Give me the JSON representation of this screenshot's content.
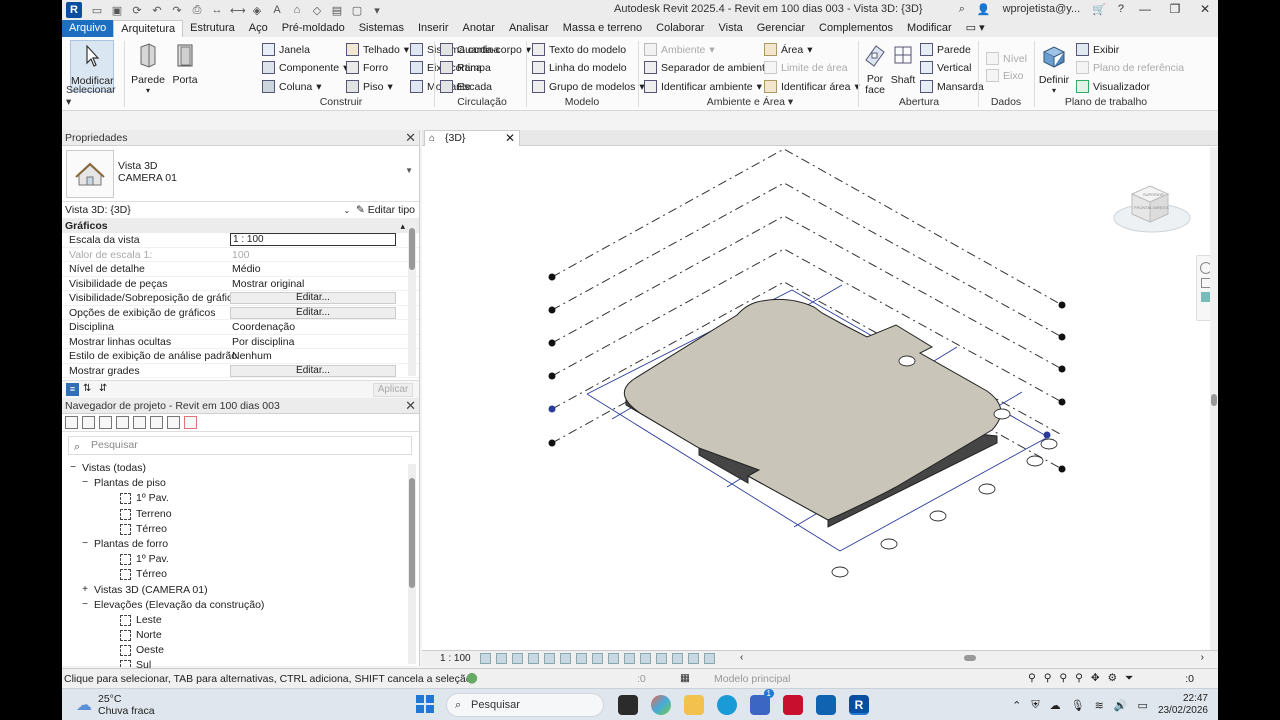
{
  "titlebar": {
    "title": "Autodesk Revit 2025.4 - Revit em 100 dias 003 - Vista 3D: {3D}",
    "user": "wprojetista@y...",
    "help": "?"
  },
  "tabs": [
    "Arquivo",
    "Arquitetura",
    "Estrutura",
    "Aço",
    "Pré-moldado",
    "Sistemas",
    "Inserir",
    "Anotar",
    "Analisar",
    "Massa e terreno",
    "Colaborar",
    "Vista",
    "Gerenciar",
    "Complementos",
    "Modificar"
  ],
  "ribbon": {
    "select": {
      "modify": "Modificar",
      "title": "Selecionar"
    },
    "build": {
      "title": "Construir",
      "wall": "Parede",
      "door": "Porta",
      "window": "Janela",
      "component": "Componente",
      "column": "Coluna",
      "roof": "Telhado",
      "ceiling": "Forro",
      "floor": "Piso",
      "curtain_system": "Sistema cortina",
      "curtain_grid": "Eixo cortina",
      "mullion": "Montante"
    },
    "circulation": {
      "title": "Circulação",
      "railing": "Guarda-corpo",
      "ramp": "Rampa",
      "stair": "Escada"
    },
    "model": {
      "title": "Modelo",
      "model_text": "Texto do modelo",
      "model_line": "Linha do modelo",
      "model_group": "Grupo de modelos"
    },
    "room": {
      "title": "Ambiente e Área",
      "room": "Ambiente",
      "separator": "Separador de ambiente",
      "tag_room": "Identificar ambiente",
      "area": "Área",
      "area_boundary": "Limite de área",
      "tag_area": "Identificar área"
    },
    "opening": {
      "title": "Abertura",
      "by_face": "Por face",
      "shaft": "Shaft",
      "wall": "Parede",
      "vertical": "Vertical",
      "dormer": "Mansarda"
    },
    "datum": {
      "title": "Dados",
      "level": "Nível",
      "grid": "Eixo"
    },
    "workplane": {
      "title": "Plano de trabalho",
      "set": "Definir",
      "show": "Exibir",
      "ref_plane": "Plano de referência",
      "viewer": "Visualizador"
    }
  },
  "properties": {
    "title": "Propriedades",
    "type_line1": "Vista 3D",
    "type_line2": "CAMERA 01",
    "view_selector": "Vista 3D: {3D}",
    "edit_type": "Editar tipo",
    "section": "Gráficos",
    "rows": [
      {
        "k": "Escala da vista",
        "v": "1 : 100"
      },
      {
        "k": "Valor de escala    1:",
        "v": "100"
      },
      {
        "k": "Nível de detalhe",
        "v": "Médio"
      },
      {
        "k": "Visibilidade de peças",
        "v": "Mostrar original"
      },
      {
        "k": "Visibilidade/Sobreposição de gráficos",
        "v": "Editar..."
      },
      {
        "k": "Opções de exibição de gráficos",
        "v": "Editar..."
      },
      {
        "k": "Disciplina",
        "v": "Coordenação"
      },
      {
        "k": "Mostrar linhas ocultas",
        "v": "Por disciplina"
      },
      {
        "k": "Estilo de exibição de análise padrão",
        "v": "Nenhum"
      },
      {
        "k": "Mostrar grades",
        "v": "Editar..."
      }
    ],
    "apply": "Aplicar"
  },
  "browser": {
    "title": "Navegador de projeto - Revit em 100 dias 003",
    "search_placeholder": "Pesquisar",
    "tree": [
      {
        "level": 0,
        "tog": "−",
        "label": "Vistas (todas)",
        "icon": false
      },
      {
        "level": 1,
        "tog": "−",
        "label": "Plantas de piso",
        "icon": false
      },
      {
        "level": 2,
        "tog": "",
        "label": "1º Pav.",
        "icon": true
      },
      {
        "level": 2,
        "tog": "",
        "label": "Terreno",
        "icon": true
      },
      {
        "level": 2,
        "tog": "",
        "label": "Térreo",
        "icon": true
      },
      {
        "level": 1,
        "tog": "−",
        "label": "Plantas de forro",
        "icon": false
      },
      {
        "level": 2,
        "tog": "",
        "label": "1º Pav.",
        "icon": true
      },
      {
        "level": 2,
        "tog": "",
        "label": "Térreo",
        "icon": true
      },
      {
        "level": 1,
        "tog": "+",
        "label": "Vistas 3D (CAMERA 01)",
        "icon": false
      },
      {
        "level": 1,
        "tog": "−",
        "label": "Elevações (Elevação da construção)",
        "icon": false
      },
      {
        "level": 2,
        "tog": "",
        "label": "Leste",
        "icon": true
      },
      {
        "level": 2,
        "tog": "",
        "label": "Norte",
        "icon": true
      },
      {
        "level": 2,
        "tog": "",
        "label": "Oeste",
        "icon": true
      },
      {
        "level": 2,
        "tog": "",
        "label": "Sul",
        "icon": true
      }
    ]
  },
  "view": {
    "tab_label": "{3D}",
    "scale": "1 : 100",
    "viewcube_labels": [
      "SUPERIOR",
      "FRONTAL",
      "DIREITA"
    ]
  },
  "statusbar": {
    "message": "Clique para selecionar, TAB para alternativas, CTRL adiciona, SHIFT cancela a seleção.",
    "workset_count": ":0",
    "model": "Modelo principal",
    "filter_count": ":0"
  },
  "taskbar": {
    "temp": "25°C",
    "weather": "Chuva fraca",
    "search": "Pesquisar",
    "badge": "1",
    "time": "22:47",
    "date": "23/02/2026"
  }
}
